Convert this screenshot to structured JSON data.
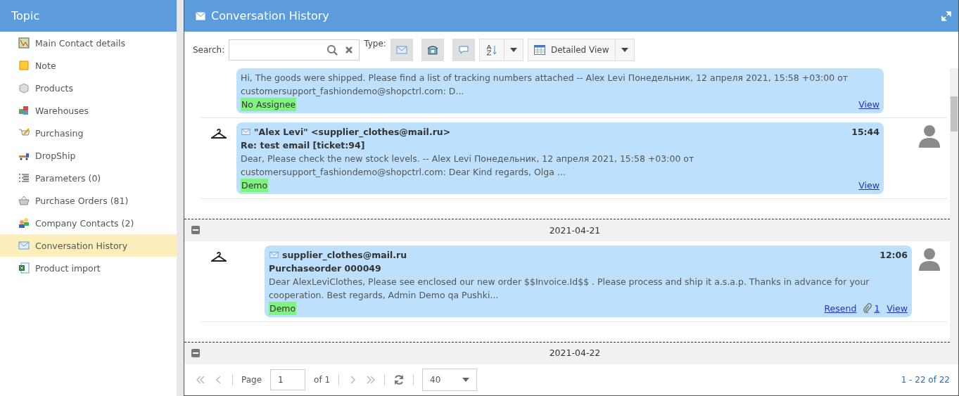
{
  "sidebar": {
    "title": "Topic",
    "items": [
      {
        "label": "Main Contact details",
        "selected": false
      },
      {
        "label": "Note",
        "selected": false
      },
      {
        "label": "Products",
        "selected": false
      },
      {
        "label": "Warehouses",
        "selected": false
      },
      {
        "label": "Purchasing",
        "selected": false
      },
      {
        "label": "DropShip",
        "selected": false
      },
      {
        "label": "Parameters (0)",
        "selected": false
      },
      {
        "label": "Purchase Orders (81)",
        "selected": false
      },
      {
        "label": "Company Contacts (2)",
        "selected": false
      },
      {
        "label": "Conversation History",
        "selected": true
      },
      {
        "label": "Product import",
        "selected": false
      }
    ]
  },
  "panel": {
    "title": "Conversation History"
  },
  "toolbar": {
    "search_label": "Search:",
    "type_label": "Type:",
    "type_filters": [
      {
        "kind": "email",
        "selected": true
      },
      {
        "kind": "phone",
        "selected": true
      },
      {
        "kind": "chat",
        "selected": true
      }
    ],
    "view": "Detailed View"
  },
  "groups": [
    {
      "messages": [
        {
          "kind": "incoming",
          "body": "Hi, The goods were shipped. Please find a list of tracking numbers attached -- Alex Levi Понедельник, 12 апреля 2021, 15:58 +03:00 от customersupport_fashiondemo@shopctrl.com: D...",
          "tag": "No Assignee",
          "view": "View"
        },
        {
          "kind": "incoming",
          "sender": "\"Alex Levi\" <supplier_clothes@mail.ru>",
          "time": "15:44",
          "subject": "Re: test email [ticket:94]",
          "body": "Dear, Please check the new stock levels. -- Alex Levi Понедельник, 12 апреля 2021, 15:58 +03:00 от customersupport_fashiondemo@shopctrl.com: Dear Kind regards, Olga ...",
          "tag": "Demo",
          "view": "View"
        }
      ]
    },
    {
      "date": "2021-04-21",
      "expanded": true,
      "messages": [
        {
          "kind": "outgoing",
          "sender": "supplier_clothes@mail.ru",
          "time": "12:06",
          "subject": "Purchaseorder 000049",
          "body": "Dear AlexLeviClothes, Please see enclosed our new order $$Invoice.Id$$ . Please process and ship it a.s.a.p. Thanks in advance for your cooperation. Best regards, Admin Demo qa Pushki...",
          "tag": "Demo",
          "resend": "Resend",
          "attachments": "1",
          "view": "View"
        }
      ]
    },
    {
      "date": "2021-04-22",
      "expanded": true
    }
  ],
  "pager": {
    "page_label": "Page",
    "page": "1",
    "of": "of 1",
    "page_size": "40",
    "summary": "1 - 22 of 22"
  }
}
